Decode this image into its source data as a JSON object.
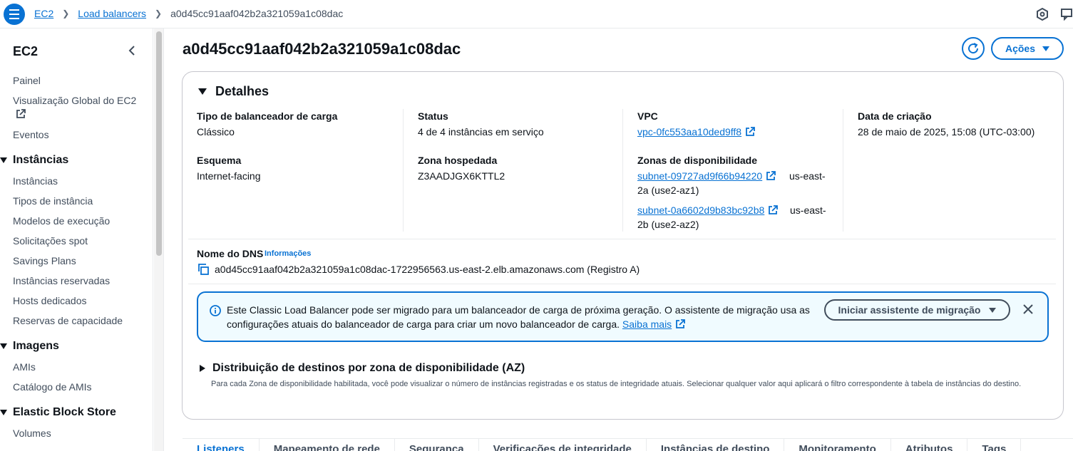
{
  "breadcrumb": {
    "items": [
      "EC2",
      "Load balancers"
    ],
    "current": "a0d45cc91aaf042b2a321059a1c08dac"
  },
  "sidebar": {
    "title": "EC2",
    "top_items": [
      "Painel",
      "Visualização Global do EC2",
      "Eventos"
    ],
    "sections": [
      {
        "title": "Instâncias",
        "items": [
          "Instâncias",
          "Tipos de instância",
          "Modelos de execução",
          "Solicitações spot",
          "Savings Plans",
          "Instâncias reservadas",
          "Hosts dedicados",
          "Reservas de capacidade"
        ]
      },
      {
        "title": "Imagens",
        "items": [
          "AMIs",
          "Catálogo de AMIs"
        ]
      },
      {
        "title": "Elastic Block Store",
        "items": [
          "Volumes"
        ]
      }
    ]
  },
  "header": {
    "title": "a0d45cc91aaf042b2a321059a1c08dac",
    "actions_label": "Ações"
  },
  "details": {
    "title": "Detalhes",
    "lb_type_label": "Tipo de balanceador de carga",
    "lb_type_value": "Clássico",
    "scheme_label": "Esquema",
    "scheme_value": "Internet-facing",
    "status_label": "Status",
    "status_value": "4 de 4 instâncias em serviço",
    "hosted_zone_label": "Zona hospedada",
    "hosted_zone_value": "Z3AADJGX6KTTL2",
    "vpc_label": "VPC",
    "vpc_value": "vpc-0fc553aa10ded9ff8",
    "az_label": "Zonas de disponibilidade",
    "az1_subnet": "subnet-09727ad9f66b94220",
    "az1_zone_a": "us-east-",
    "az1_zone_b": "2a (use2-az1)",
    "az2_subnet": "subnet-0a6602d9b83bc92b8",
    "az2_zone_a": "us-east-",
    "az2_zone_b": "2b (use2-az2)",
    "created_label": "Data de criação",
    "created_value": "28 de maio de 2025, 15:08 (UTC-03:00)",
    "dns_label": "Nome do DNS",
    "dns_info": "Informações",
    "dns_value": "a0d45cc91aaf042b2a321059a1c08dac-1722956563.us-east-2.elb.amazonaws.com (Registro A)"
  },
  "alert": {
    "text": "Este Classic Load Balancer pode ser migrado para um balanceador de carga de próxima geração. O assistente de migração usa as configurações atuais do balanceador de carga para criar um novo balanceador de carga.",
    "link": "Saiba mais",
    "button": "Iniciar assistente de migração"
  },
  "distribution": {
    "title": "Distribuição de destinos por zona de disponibilidade (AZ)",
    "description": "Para cada Zona de disponibilidade habilitada, você pode visualizar o número de instâncias registradas e os status de integridade atuais. Selecionar qualquer valor aqui aplicará o filtro correspondente à tabela de instâncias do destino."
  },
  "tabs": [
    "Listeners",
    "Mapeamento de rede",
    "Segurança",
    "Verificações de integridade",
    "Instâncias de destino",
    "Monitoramento",
    "Atributos",
    "Tags"
  ],
  "colors": {
    "accent": "#0972d3",
    "alert_bg": "#f0fbff",
    "text": "#0f141a",
    "muted": "#414d5c"
  }
}
